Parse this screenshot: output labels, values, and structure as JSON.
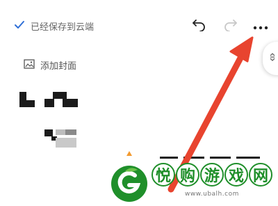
{
  "header": {
    "saved_label": "已经保存到云端",
    "icons": {
      "saved": "check-icon",
      "undo": "undo-icon",
      "redo": "redo-icon",
      "more": "more-icon",
      "handle": "expand-icon"
    }
  },
  "cover": {
    "label": "添加封面",
    "icon": "image-icon"
  },
  "watermark": {
    "chars": [
      "悦",
      "购",
      "游",
      "戏",
      "网"
    ],
    "url": "www.ubalh.com"
  },
  "colors": {
    "accent": "#2f6fd6",
    "arrow": "#e8442f",
    "watermark_green": "#1f8f2a",
    "cursor": "#f39a2f"
  }
}
